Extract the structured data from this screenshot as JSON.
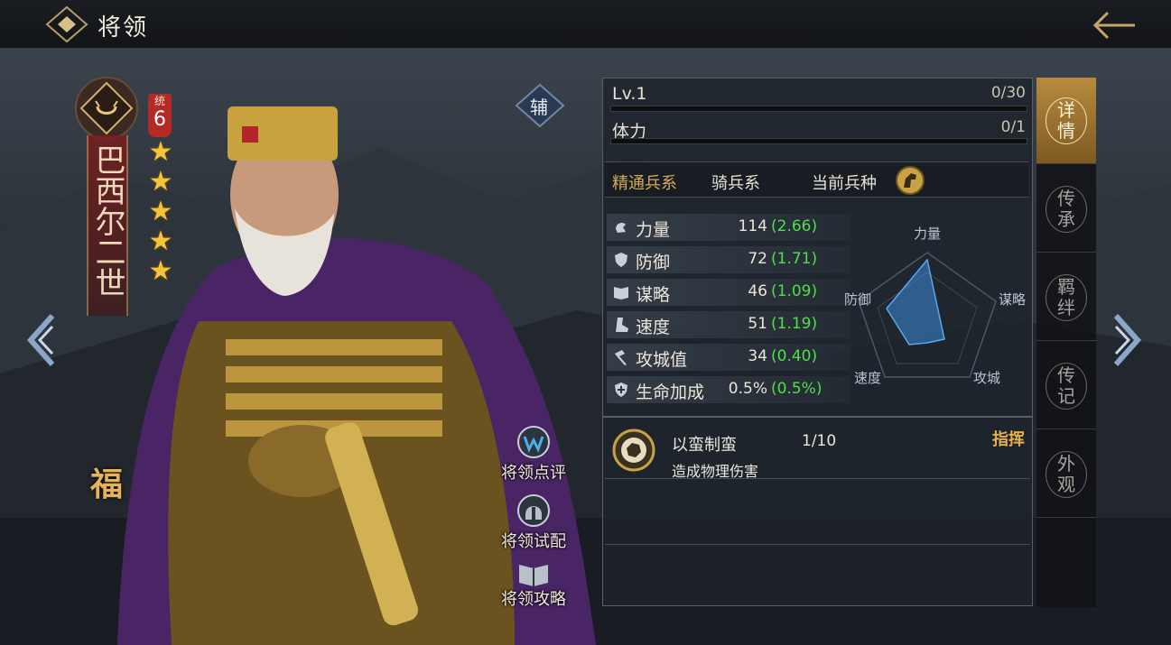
{
  "header": {
    "title": "将领"
  },
  "hero": {
    "name": "巴西尔二世",
    "command_label": "统",
    "command_value": "6",
    "stars": [
      "★",
      "★",
      "★",
      "★",
      "★"
    ],
    "fu_label": "福",
    "aux_label": "辅"
  },
  "side_actions": [
    {
      "label": "将领点评",
      "icon": "comment-icon"
    },
    {
      "label": "将领试配",
      "icon": "helmet-icon"
    },
    {
      "label": "将领攻略",
      "icon": "book-icon"
    }
  ],
  "panel": {
    "level_label": "Lv.1",
    "exp_value": "0/30",
    "exp_progress": 0,
    "stamina_label": "体力",
    "stamina_value": "0/1",
    "stamina_progress": 0,
    "troop_key": "精通兵系",
    "troop_value": "骑兵系",
    "current_troop_label": "当前兵种",
    "current_troop_icon": "horse-icon"
  },
  "stats": [
    {
      "label": "力量",
      "value": "114",
      "growth": "(2.66)",
      "icon": "fist-icon"
    },
    {
      "label": "防御",
      "value": "72",
      "growth": "(1.71)",
      "icon": "shield-icon"
    },
    {
      "label": "谋略",
      "value": "46",
      "growth": "(1.09)",
      "icon": "book-icon"
    },
    {
      "label": "速度",
      "value": "51",
      "growth": "(1.19)",
      "icon": "boot-icon"
    },
    {
      "label": "攻城值",
      "value": "34",
      "growth": "(0.40)",
      "icon": "hammer-icon"
    },
    {
      "label": "生命加成",
      "value": "0.5%",
      "growth": "(0.5%)",
      "icon": "cross-icon"
    }
  ],
  "radar": {
    "labels": {
      "strength": "力量",
      "strategy": "谋略",
      "siege": "攻城",
      "speed": "速度",
      "defense": "防御"
    }
  },
  "skill": {
    "name": "以蛮制蛮",
    "level": "1/10",
    "description": "造成物理伤害",
    "type": "指挥",
    "icon": "skill-emblem-icon"
  },
  "tabs": [
    {
      "label": "详情",
      "active": true
    },
    {
      "label": "传承",
      "active": false
    },
    {
      "label": "羁绊",
      "active": false
    },
    {
      "label": "传记",
      "active": false
    },
    {
      "label": "外观",
      "active": false
    }
  ],
  "colors": {
    "accent_gold": "#c9a84a",
    "growth_green": "#4ee04a",
    "command_red": "#b32a26"
  }
}
